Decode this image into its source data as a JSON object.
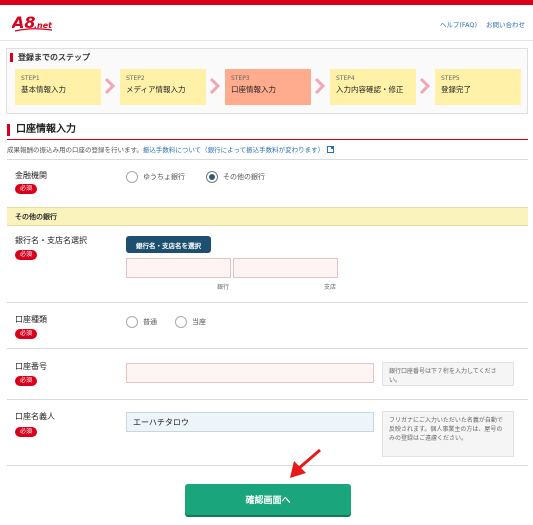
{
  "header": {
    "logo_text": "A8.net",
    "links": [
      "ヘルプ(FAQ)",
      "お問い合わせ"
    ]
  },
  "steps": {
    "title": "登録までのステップ",
    "items": [
      {
        "num": "STEP1",
        "label": "基本情報入力",
        "active": false
      },
      {
        "num": "STEP2",
        "label": "メディア情報入力",
        "active": false
      },
      {
        "num": "STEP3",
        "label": "口座情報入力",
        "active": true
      },
      {
        "num": "STEP4",
        "label": "入力内容確認・修正",
        "active": false
      },
      {
        "num": "STEP5",
        "label": "登録完了",
        "active": false
      }
    ]
  },
  "section": {
    "title": "口座情報入力",
    "intro_text": "成果報酬の振込み用の口座の登録を行います。",
    "intro_link": "振込手数料について（銀行によって振込手数料が変わります）"
  },
  "required_label": "必須",
  "bank": {
    "label": "金融機関",
    "options": [
      "ゆうちょ銀行",
      "その他の銀行"
    ],
    "selected": "その他の銀行"
  },
  "other_bank": {
    "band_label": "その他の銀行",
    "branch_label": "銀行名・支店名選択",
    "select_button": "銀行名・支店名を選択",
    "bank_field_label": "銀行",
    "branch_field_label": "支店",
    "bank_value": "",
    "branch_value": ""
  },
  "account_type": {
    "label": "口座種類",
    "options": [
      "普通",
      "当座"
    ]
  },
  "account_number": {
    "label": "口座番号",
    "value": "",
    "note": "銀行口座番号は下７桁を入力してください。"
  },
  "account_holder": {
    "label": "口座名義人",
    "value": "エーハチタロウ",
    "note": "フリガナにご入力いただいた名義が自動で反映されます。個人事業主の方は、屋号のみの登録はご遠慮ください。"
  },
  "confirm_button": "確認画面へ",
  "colors": {
    "brand": "#d9001b",
    "step": "#fff2a8",
    "step_active": "#ffab8d",
    "confirm": "#1aa57c",
    "select_button": "#1d4f6e"
  }
}
